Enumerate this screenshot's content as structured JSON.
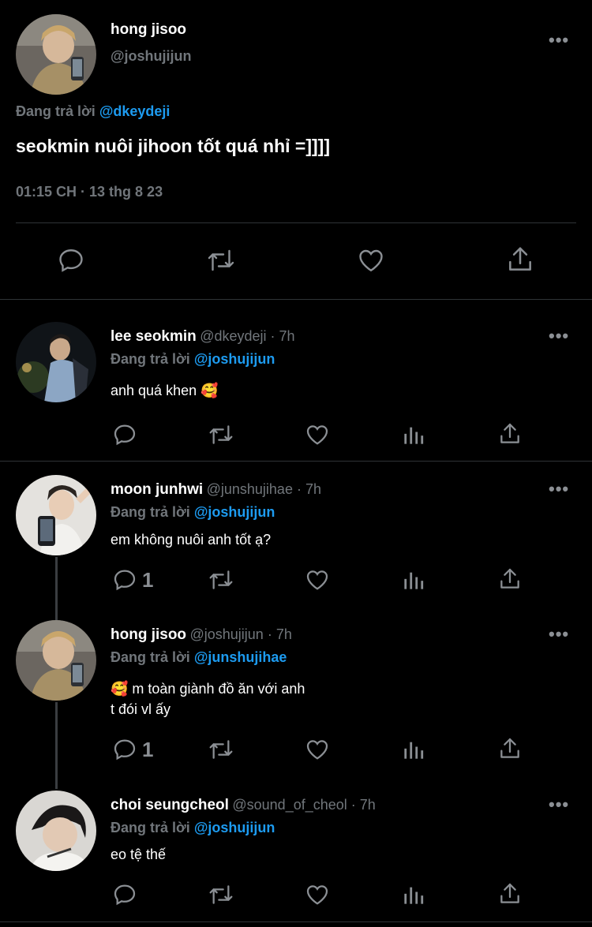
{
  "main_tweet": {
    "name": "hong jisoo",
    "handle": "@joshujijun",
    "reply_prefix": "Đang trả lời",
    "reply_to": "@dkeydeji",
    "text": "seokmin nuôi jihoon tốt quá nhỉ =]]]]",
    "timestamp": "01:15 CH · 13 thg 8 23"
  },
  "replies": [
    {
      "name": "lee seokmin",
      "meta": "@dkeydeji · 7h",
      "reply_prefix": "Đang trả lời",
      "reply_to": "@joshujijun",
      "text_lines": [
        "anh quá khen 🥰"
      ],
      "reply_count": ""
    },
    {
      "name": "moon junhwi",
      "meta": "@junshujihae · 7h",
      "reply_prefix": "Đang trả lời",
      "reply_to": "@joshujijun",
      "text_lines": [
        "em không nuôi anh tốt ạ?"
      ],
      "reply_count": "1"
    },
    {
      "name": "hong jisoo",
      "meta": "@joshujijun · 7h",
      "reply_prefix": "Đang trả lời",
      "reply_to": "@junshujihae",
      "text_lines": [
        "🥰 m toàn giành đồ ăn với anh",
        "t đói vl ấy"
      ],
      "reply_count": "1"
    },
    {
      "name": "choi seungcheol",
      "meta": "@sound_of_cheol · 7h",
      "reply_prefix": "Đang trả lời",
      "reply_to": "@joshujijun",
      "text_lines": [
        "eo tệ thế"
      ],
      "reply_count": ""
    }
  ],
  "more_label": "•••",
  "icons": [
    "reply-icon",
    "retweet-icon",
    "like-icon",
    "analytics-icon",
    "share-icon",
    "more-icon"
  ],
  "colors": {
    "background": "#000000",
    "accent": "#1d9bf0",
    "muted": "#71767b",
    "divider": "#2f3336"
  }
}
